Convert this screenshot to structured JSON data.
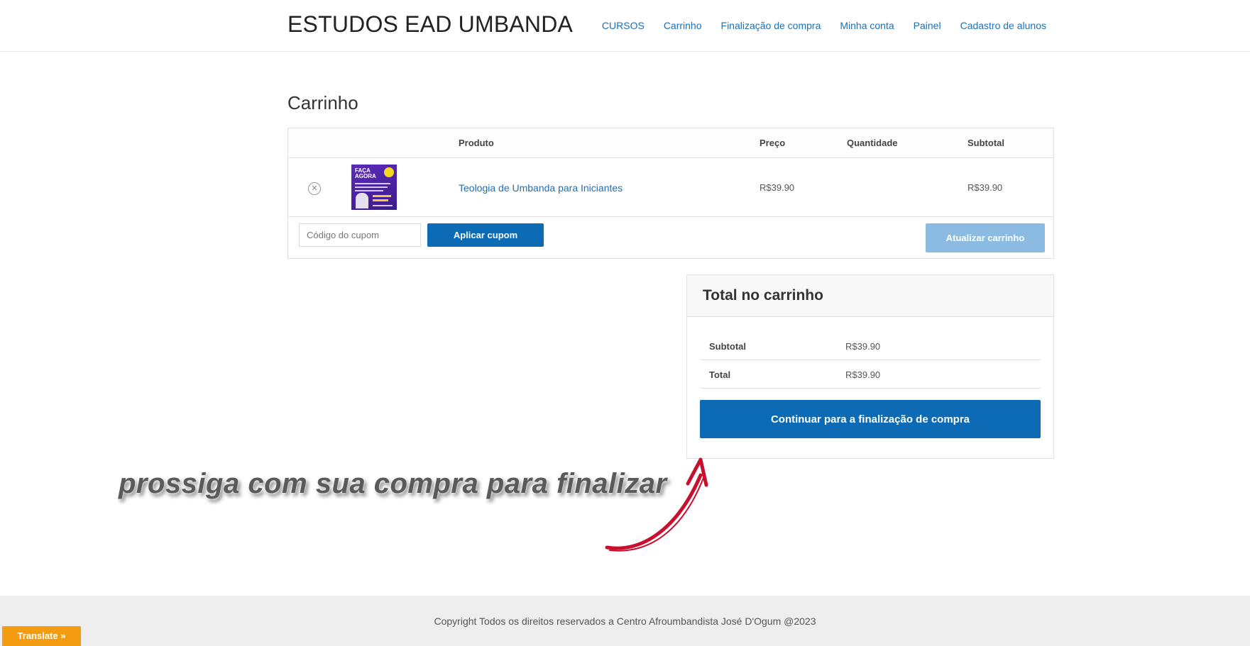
{
  "header": {
    "site_title": "ESTUDOS EAD UMBANDA",
    "nav": [
      "CURSOS",
      "Carrinho",
      "Finalização de compra",
      "Minha conta",
      "Painel",
      "Cadastro de alunos"
    ]
  },
  "page": {
    "title": "Carrinho"
  },
  "cart": {
    "columns": {
      "product": "Produto",
      "price": "Preço",
      "quantity": "Quantidade",
      "subtotal": "Subtotal"
    },
    "items": [
      {
        "remove_icon": "remove-circle-icon",
        "thumbnail_text": "FAÇA AGORA",
        "product": "Teologia de Umbanda para Iniciantes",
        "price": "R$39.90",
        "subtotal": "R$39.90"
      }
    ],
    "coupon_placeholder": "Código do cupom",
    "apply_coupon_label": "Aplicar cupom",
    "update_cart_label": "Atualizar carrinho"
  },
  "totals": {
    "title": "Total no carrinho",
    "rows": [
      {
        "label": "Subtotal",
        "value": "R$39.90"
      },
      {
        "label": "Total",
        "value": "R$39.90"
      }
    ],
    "checkout_label": "Continuar para a finalização de compra"
  },
  "annotation": {
    "text": "prossiga com sua compra para finalizar",
    "arrow_color": "#c8102e"
  },
  "footer": {
    "copyright": "Copyright Todos os direitos reservados a Centro Afroumbandista José D'Ogum @2023",
    "translate_label": "Translate »"
  },
  "colors": {
    "link": "#1e6fb4",
    "primary_button": "#0c6bb4",
    "disabled_button": "#8bbbe0",
    "translate_bg": "#f39c12"
  }
}
